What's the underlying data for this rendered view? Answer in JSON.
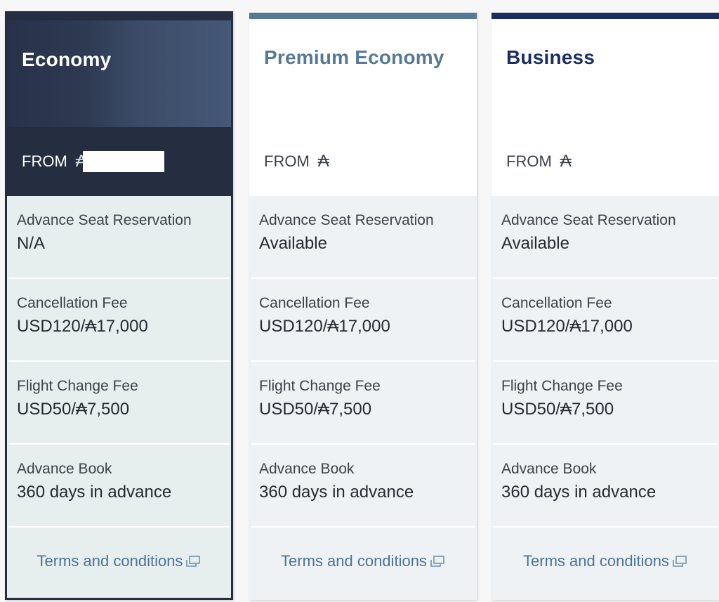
{
  "cards": [
    {
      "title": "Economy",
      "from_label": "FROM",
      "currency_symbol": "₳",
      "price_redacted": true,
      "selected": true,
      "accent": "#252e40",
      "rows": [
        {
          "label": "Advance Seat Reservation",
          "value": "N/A"
        },
        {
          "label": "Cancellation Fee",
          "value": "USD120/₳17,000"
        },
        {
          "label": "Flight Change Fee",
          "value": "USD50/₳7,500"
        },
        {
          "label": "Advance Book",
          "value": "360 days in advance"
        }
      ],
      "terms_link": "Terms and conditions",
      "terms_icon": "external-window-icon"
    },
    {
      "title": "Premium Economy",
      "from_label": "FROM",
      "currency_symbol": "₳",
      "price_redacted": false,
      "selected": false,
      "accent": "#557893",
      "rows": [
        {
          "label": "Advance Seat Reservation",
          "value": "Available"
        },
        {
          "label": "Cancellation Fee",
          "value": "USD120/₳17,000"
        },
        {
          "label": "Flight Change Fee",
          "value": "USD50/₳7,500"
        },
        {
          "label": "Advance Book",
          "value": "360 days in advance"
        }
      ],
      "terms_link": "Terms and conditions",
      "terms_icon": "external-window-icon"
    },
    {
      "title": "Business",
      "from_label": "FROM",
      "currency_symbol": "₳",
      "price_redacted": false,
      "selected": false,
      "accent": "#1b2d5e",
      "rows": [
        {
          "label": "Advance Seat Reservation",
          "value": "Available"
        },
        {
          "label": "Cancellation Fee",
          "value": "USD120/₳17,000"
        },
        {
          "label": "Flight Change Fee",
          "value": "USD50/₳7,500"
        },
        {
          "label": "Advance Book",
          "value": "360 days in advance"
        }
      ],
      "terms_link": "Terms and conditions",
      "terms_icon": "external-window-icon"
    }
  ]
}
